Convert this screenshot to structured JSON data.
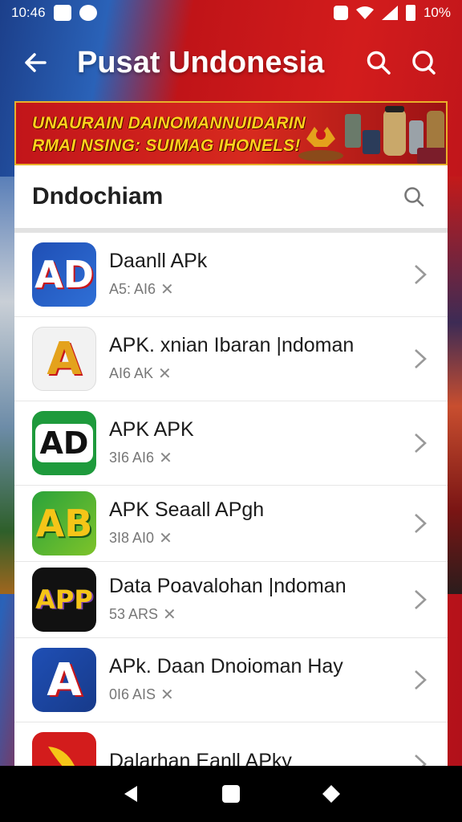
{
  "status_bar": {
    "time": "10:46",
    "battery": "10%"
  },
  "app_bar": {
    "title": "Pusat Undonesia"
  },
  "banner": {
    "line1": "UNAURAIN DAINOMANNUIDARIN",
    "line2": "RMAI NSING: SUIMAG IHONELS!"
  },
  "search": {
    "query": "Dndochiam"
  },
  "apps": [
    {
      "name": "Daanll APk",
      "meta": "A5: AI6",
      "icon_text": "AD"
    },
    {
      "name": "APK. xnian Ibaran |ndoman",
      "meta": "AI6 AK",
      "icon_text": "A"
    },
    {
      "name": "APK APK",
      "meta": "3I6 AI6",
      "icon_text": "AD"
    },
    {
      "name": "APK Seaall APgh",
      "meta": "3I8 AI0",
      "icon_text": "AB"
    },
    {
      "name": "Data Poavalohan |ndoman",
      "meta": "53 ARS",
      "icon_text": "APP"
    },
    {
      "name": "APk. Daan Dnoioman Hay",
      "meta": "0I6 AIS",
      "icon_text": "A"
    },
    {
      "name": "Dalarhan Eanll APky",
      "meta": "",
      "icon_text": ""
    }
  ],
  "colors": {
    "accent_red": "#c8161b",
    "flag_blue": "#2a62b8",
    "banner_gold": "#ffd21c"
  }
}
